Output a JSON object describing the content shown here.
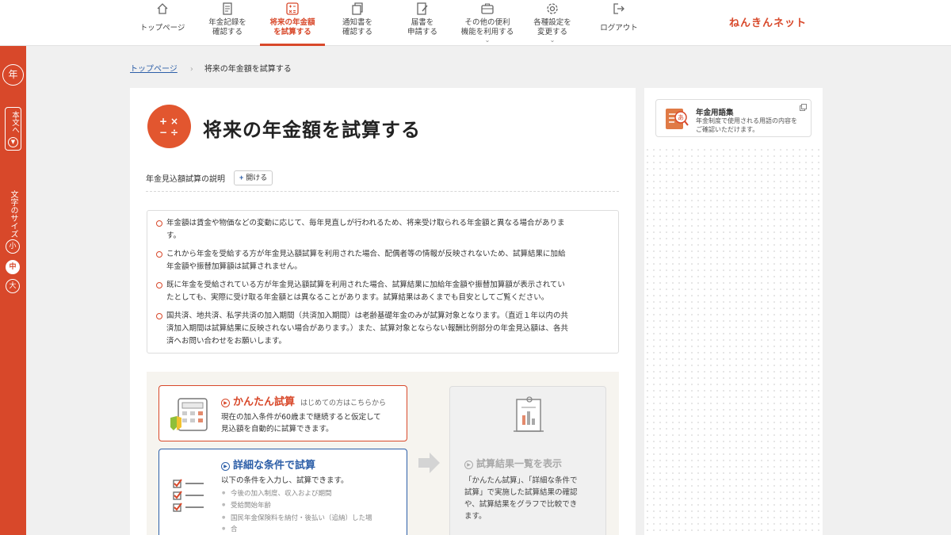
{
  "nav": {
    "items": [
      {
        "label": "トップページ",
        "icon": "home-icon",
        "active": false
      },
      {
        "label": "年金記録を\n確認する",
        "icon": "record-book-icon",
        "active": false
      },
      {
        "label": "将来の年金額\nを試算する",
        "icon": "calculator-icon",
        "active": true
      },
      {
        "label": "通知書を\n確認する",
        "icon": "documents-icon",
        "active": false
      },
      {
        "label": "届書を\n申請する",
        "icon": "form-pen-icon",
        "active": false
      },
      {
        "label": "その他の便利\n機能を利用する",
        "icon": "briefcase-icon",
        "active": false,
        "dropdown": true
      },
      {
        "label": "各種設定を\n変更する",
        "icon": "gear-icon",
        "active": false,
        "dropdown": true
      },
      {
        "label": "ログアウト",
        "icon": "logout-icon",
        "active": false
      }
    ],
    "brand": "ねんきんネット"
  },
  "rail": {
    "logo_text": "年",
    "skip_label": "本文へ",
    "font_size_title": "文字のサイズ",
    "sizes": [
      "小",
      "中",
      "大"
    ],
    "selected_size": "中"
  },
  "breadcrumb": {
    "home": "トップページ",
    "current": "将来の年金額を試算する"
  },
  "main": {
    "title": "将来の年金額を試算する",
    "explanation_label": "年金見込額試算の説明",
    "open_button": "開ける",
    "notes": [
      "年金額は賃金や物価などの変動に応じて、毎年見直しが行われるため、将来受け取られる年金額と異なる場合がありま",
      "す。",
      "これから年金を受給する方が年金見込額試算を利用された場合、配偶者等の情報が反映されないため、試算結果に加給",
      "年金額や振替加算額は試算されません。",
      "既に年金を受給されている方が年金見込額試算を利用された場合、試算結果に加給年金額や振替加算額が表示されてい",
      "たとしても、実際に受け取る年金額とは異なることがあります。試算結果はあくまでも目安としてご覧ください。",
      "国共済、地共済、私学共済の加入期間（共済加入期間）は老齢基礎年金のみが試算対象となります。（直近１年以内の共",
      "済加入期間は試算結果に反映されない場合があります。）また、試算対象とならない報酬比例部分の年金見込額は、各共",
      "済へお問い合わせをお願いします。"
    ],
    "easy": {
      "title": "かんたん試算",
      "subtitle": "はじめての方はこちらから",
      "text1": "現在の加入条件が60歳まで継続すると仮定して",
      "text2": "見込額を自動的に試算できます。"
    },
    "detail": {
      "title": "詳細な条件で試算",
      "text": "以下の条件を入力し、試算できます。",
      "bullets": [
        "今後の加入制度、収入および期間",
        "受給開始年齢",
        "国民年金保険料を納付・後払い（追納）した場"
      ],
      "bullet_tail": "合"
    },
    "result": {
      "title": "試算結果一覧を表示",
      "text": [
        "「かんたん試算」、「詳細な条件で",
        "試算」で実施した試算結果の確認",
        "や、試算結果をグラフで比較でき",
        "ます。"
      ]
    }
  },
  "aside": {
    "glossary_title": "年金用語集",
    "glossary_desc1": "年金制度で使用される用語の内容を",
    "glossary_desc2": "ご確認いただけます。"
  },
  "colors": {
    "accent": "#d8482a",
    "link": "#2d5fa8",
    "background": "#f0f0f0"
  }
}
